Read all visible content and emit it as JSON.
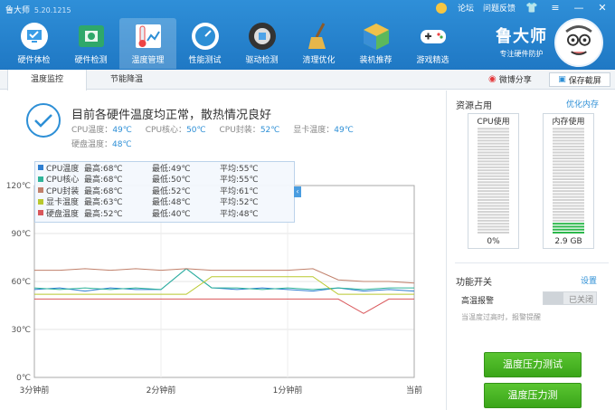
{
  "app": {
    "name": "鲁大师",
    "version": "5.20.1215"
  },
  "topbar": {
    "forum": "论坛",
    "feedback": "问题反馈"
  },
  "nav": [
    {
      "label": "硬件体检",
      "icon": "monitor-check-icon"
    },
    {
      "label": "硬件检测",
      "icon": "circuit-board-icon"
    },
    {
      "label": "温度管理",
      "icon": "thermometer-icon"
    },
    {
      "label": "性能测试",
      "icon": "speedometer-icon"
    },
    {
      "label": "驱动检测",
      "icon": "driver-icon"
    },
    {
      "label": "清理优化",
      "icon": "broom-icon"
    },
    {
      "label": "装机推荐",
      "icon": "box-icon"
    },
    {
      "label": "游戏精选",
      "icon": "gamepad-icon"
    }
  ],
  "brand": {
    "name": "鲁大师",
    "slogan": "专注硬件防护"
  },
  "subtabs": [
    "温度监控",
    "节能降温"
  ],
  "share": {
    "weibo": "微博分享",
    "screenshot": "保存截屏"
  },
  "status": {
    "message": "目前各硬件温度均正常，散热情况良好",
    "readings": [
      {
        "label": "CPU温度：",
        "value": "49℃"
      },
      {
        "label": "CPU核心：",
        "value": "50℃"
      },
      {
        "label": "CPU封装：",
        "value": "52℃"
      },
      {
        "label": "显卡温度：",
        "value": "49℃"
      },
      {
        "label": "硬盘温度：",
        "value": "48℃"
      }
    ]
  },
  "legend": [
    {
      "name": "CPU温度",
      "max": "最高:68℃",
      "min": "最低:49℃",
      "avg": "平均:55℃",
      "color": "#2f7fd1"
    },
    {
      "name": "CPU核心",
      "max": "最高:68℃",
      "min": "最低:50℃",
      "avg": "平均:55℃",
      "color": "#2fb49a"
    },
    {
      "name": "CPU封装",
      "max": "最高:68℃",
      "min": "最低:52℃",
      "avg": "平均:61℃",
      "color": "#c1806b"
    },
    {
      "name": "显卡温度",
      "max": "最高:63℃",
      "min": "最低:48℃",
      "avg": "平均:52℃",
      "color": "#b9c82e"
    },
    {
      "name": "硬盘温度",
      "max": "最高:52℃",
      "min": "最低:40℃",
      "avg": "平均:48℃",
      "color": "#d9575b"
    }
  ],
  "chart_data": {
    "type": "line",
    "ylim": [
      0,
      120
    ],
    "yticks": [
      "0℃",
      "30℃",
      "60℃",
      "90℃",
      "120℃"
    ],
    "xticks": [
      "3分钟前",
      "2分钟前",
      "1分钟前",
      "当前"
    ],
    "x": [
      0,
      12,
      24,
      36,
      48,
      60,
      72,
      84,
      96,
      108,
      120,
      132,
      144,
      156,
      168,
      180
    ],
    "series": [
      {
        "name": "CPU温度",
        "color": "#2f7fd1",
        "values": [
          55,
          56,
          54,
          56,
          55,
          55,
          68,
          56,
          55,
          56,
          55,
          54,
          56,
          54,
          55,
          54
        ]
      },
      {
        "name": "CPU核心",
        "color": "#2fb49a",
        "values": [
          56,
          55,
          56,
          55,
          56,
          55,
          68,
          56,
          56,
          55,
          56,
          55,
          56,
          55,
          56,
          56
        ]
      },
      {
        "name": "CPU封装",
        "color": "#c1806b",
        "values": [
          67,
          67,
          68,
          67,
          68,
          67,
          68,
          67,
          67,
          67,
          67,
          68,
          61,
          60,
          60,
          59
        ]
      },
      {
        "name": "显卡温度",
        "color": "#b9c82e",
        "values": [
          52,
          52,
          52,
          52,
          52,
          52,
          52,
          63,
          63,
          63,
          63,
          63,
          52,
          52,
          52,
          52
        ]
      },
      {
        "name": "硬盘温度",
        "color": "#d9575b",
        "values": [
          49,
          49,
          49,
          49,
          49,
          49,
          49,
          49,
          49,
          49,
          49,
          49,
          49,
          40,
          49,
          49
        ]
      }
    ]
  },
  "right": {
    "usage_title": "资源占用",
    "optimize": "优化内存",
    "cpu": {
      "label": "CPU使用",
      "value": "0%",
      "fill": 0
    },
    "mem": {
      "label": "内存使用",
      "value": "2.9 GB",
      "fill": 0.12
    },
    "func_title": "功能开关",
    "settings": "设置",
    "alarm_label": "高温报警",
    "alarm_state": "已关闭",
    "alarm_desc": "当温度过高时，报警提醒",
    "btn_stress": "温度压力测试",
    "btn_stress2": "温度压力测"
  }
}
